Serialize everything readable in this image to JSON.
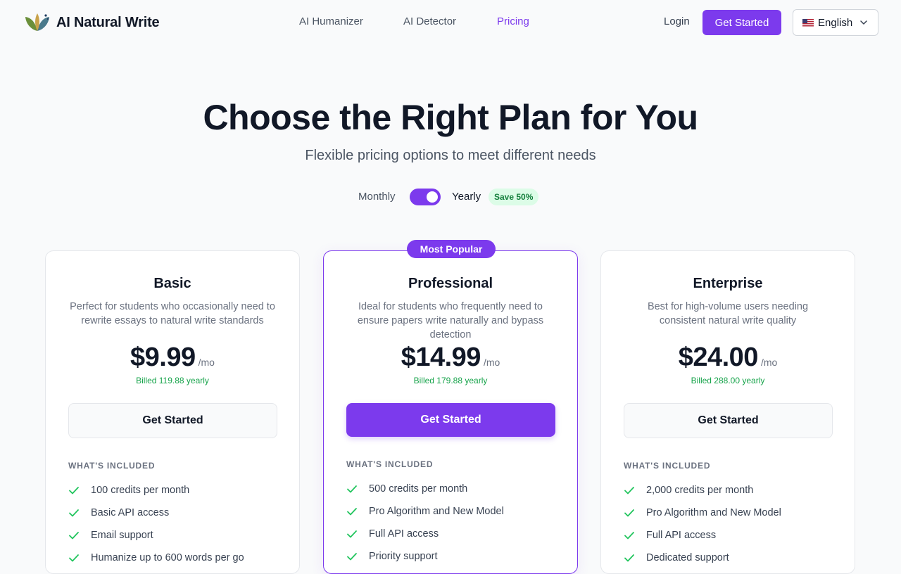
{
  "brand": {
    "name": "AI Natural Write",
    "logo_icon": "leaf-logo-icon"
  },
  "nav": {
    "links": [
      "AI Humanizer",
      "AI Detector",
      "Pricing"
    ],
    "active": "Pricing",
    "login": "Login",
    "get_started": "Get Started",
    "language": "English"
  },
  "hero": {
    "title": "Choose the Right Plan for You",
    "subtitle": "Flexible pricing options to meet different needs"
  },
  "billing_toggle": {
    "monthly": "Monthly",
    "yearly": "Yearly",
    "save": "Save 50%",
    "selected": "Yearly"
  },
  "colors": {
    "accent": "#7c3aed",
    "success": "#16a34a",
    "save_bg": "#dcfce7"
  },
  "plans": [
    {
      "name": "Basic",
      "description": "Perfect for students who occasionally need to rewrite essays to natural write standards",
      "price": "$9.99",
      "per": "/mo",
      "billed": "Billed 119.88 yearly",
      "cta": "Get Started",
      "included_label": "WHAT'S INCLUDED",
      "features": [
        "100 credits per month",
        "Basic API access",
        "Email support",
        "Humanize up to 600 words per go"
      ]
    },
    {
      "name": "Professional",
      "badge": "Most Popular",
      "description": "Ideal for students who frequently need to ensure papers write naturally and bypass detection",
      "price": "$14.99",
      "per": "/mo",
      "billed": "Billed 179.88 yearly",
      "cta": "Get Started",
      "included_label": "WHAT'S INCLUDED",
      "features": [
        "500 credits per month",
        "Pro Algorithm and New Model",
        "Full API access",
        "Priority support"
      ]
    },
    {
      "name": "Enterprise",
      "description": "Best for high-volume users needing consistent natural write quality",
      "price": "$24.00",
      "per": "/mo",
      "billed": "Billed 288.00 yearly",
      "cta": "Get Started",
      "included_label": "WHAT'S INCLUDED",
      "features": [
        "2,000 credits per month",
        "Pro Algorithm and New Model",
        "Full API access",
        "Dedicated support"
      ]
    }
  ]
}
